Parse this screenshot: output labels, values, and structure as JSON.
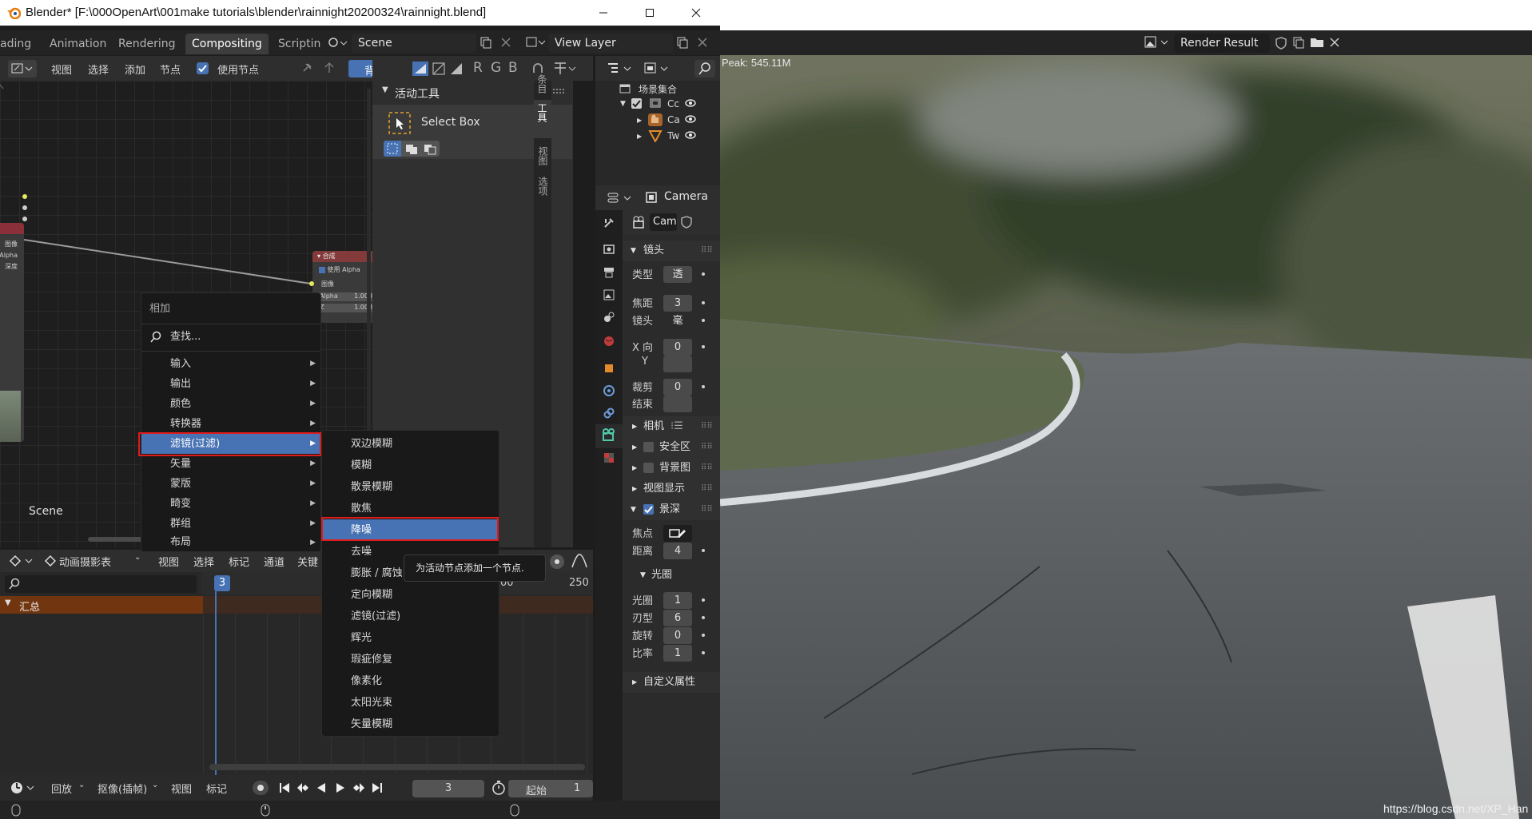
{
  "window": {
    "title": "Blender* [F:\\000OpenArt\\001make tutorials\\blender\\rainnight20200324\\rainnight.blend]"
  },
  "workspace_tabs": [
    "ading",
    "Animation",
    "Rendering",
    "Compositing",
    "Scriptin"
  ],
  "active_tab": "Compositing",
  "scene_field": "Scene",
  "view_layer_field": "View Layer",
  "node_header": {
    "menus": [
      "视图",
      "选择",
      "添加",
      "节点"
    ],
    "use_nodes_label": "使用节点",
    "backdrop_button": "背景图",
    "channels": [
      "R",
      "G",
      "B"
    ]
  },
  "nodes": {
    "composite": {
      "title": "合成",
      "use_alpha": "使用 Alpha",
      "image_socket": "图像",
      "alpha_label": "Alpha",
      "alpha_value": "1.000",
      "z_label": "Z",
      "z_value": "1.000"
    },
    "render_layers_sockets": [
      "图像",
      "Alpha",
      "深度"
    ]
  },
  "node_editor_label": "Scene",
  "sidebar": {
    "tabs": [
      "条目",
      "工具",
      "视图",
      "选项"
    ],
    "panel_title": "活动工具",
    "tool_name": "Select Box"
  },
  "add_menu": {
    "title": "相加",
    "search": "查找...",
    "items": [
      "输入",
      "输出",
      "颜色",
      "转换器",
      "滤镜(过滤)",
      "矢量",
      "蒙版",
      "畸变",
      "群组",
      "布局"
    ],
    "selected": "滤镜(过滤)"
  },
  "filter_submenu": {
    "items": [
      "双边模糊",
      "模糊",
      "散景模糊",
      "散焦",
      "降噪",
      "去噪",
      "膨胀 / 腐蚀",
      "定向模糊",
      "滤镜(过滤)",
      "辉光",
      "瑕疵修复",
      "像素化",
      "太阳光束",
      "矢量模糊"
    ],
    "selected": "降噪"
  },
  "tooltip": "为活动节点添加一个节点.",
  "timeline": {
    "editor": "动画摄影表",
    "menus": [
      "视图",
      "选择",
      "标记",
      "通道",
      "关键"
    ],
    "summary": "汇总",
    "current_frame": "3",
    "ticks": [
      "50",
      "00",
      "250"
    ]
  },
  "playback": {
    "menus": [
      "回放",
      "抠像(插帧)",
      "视图",
      "标记"
    ],
    "frame": "3",
    "start_label": "起始",
    "start_value": "1"
  },
  "outliner": {
    "root": "场景集合",
    "items": [
      "Cc",
      "Ca",
      "Tw"
    ]
  },
  "properties": {
    "object_name": "Camera",
    "data_name": "Cam",
    "lens_panel": "镜头",
    "rows": [
      {
        "label": "类型",
        "value": "透"
      },
      {
        "label": "焦距",
        "value": "3"
      },
      {
        "label": "镜头",
        "value": "毫"
      },
      {
        "label": "X 向",
        "value": "0"
      },
      {
        "label": "Y",
        "value": ""
      },
      {
        "label": "裁剪",
        "value": "0"
      },
      {
        "label": "结束",
        "value": ""
      }
    ],
    "collapsed_panels": [
      "相机",
      "安全区",
      "背景图",
      "视图显示"
    ],
    "dof_panel": "景深",
    "dof_rows": [
      {
        "label": "焦点",
        "value": ""
      },
      {
        "label": "距离",
        "value": "4"
      }
    ],
    "aperture_panel": "光圈",
    "aperture_rows": [
      {
        "label": "光圈",
        "value": "1"
      },
      {
        "label": "刃型",
        "value": "6"
      },
      {
        "label": "旋转",
        "value": "0"
      },
      {
        "label": "比率",
        "value": "1"
      }
    ],
    "custom_props": "自定义属性"
  },
  "render": {
    "title": "Render Result",
    "peak": "Peak: 545.11M",
    "watermark": "https://blog.csdn.net/XP_Han"
  },
  "colors": {
    "accent": "#4772b3",
    "highlight_red": "#e11a1a",
    "node_header": "#833a3a"
  }
}
